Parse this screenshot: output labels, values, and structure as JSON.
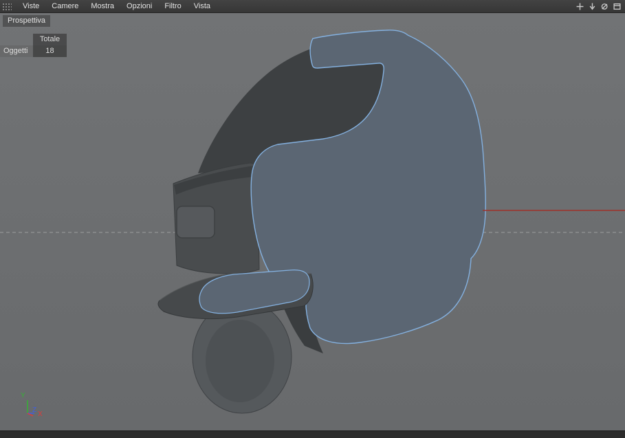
{
  "menubar": {
    "items": [
      "Viste",
      "Camere",
      "Mostra",
      "Opzioni",
      "Filtro",
      "Vista"
    ],
    "right_icon_names": [
      "move-icon",
      "arrow-down-icon",
      "zoom-icon",
      "window-icon"
    ]
  },
  "viewport": {
    "view_label": "Prospettiva",
    "stats": {
      "column_header": "Totale",
      "row_label": "Oggetti",
      "row_value": "18"
    },
    "axis": {
      "x_label": "X",
      "y_label": "Y",
      "z_label": "Z"
    },
    "colors": {
      "viewport_bg_top": "#717375",
      "viewport_bg_bottom": "#686a6c",
      "mesh_fill": "#5b6673",
      "mesh_wire": "#84b1e0",
      "body_dark": "#46494b",
      "interior_dark": "#3d4042",
      "front_panel": "#494c4e",
      "wheel_fill": "#55595c",
      "dashed_line": "#c4c4c4",
      "red_line": "#a03028",
      "axis_x_color": "#e03a3a",
      "axis_y_color": "#35b135",
      "axis_z_color": "#4060e0"
    }
  }
}
